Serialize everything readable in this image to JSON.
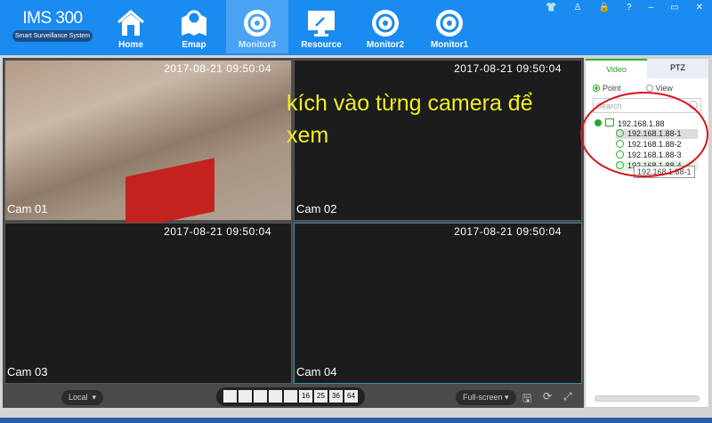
{
  "app": {
    "title": "IMS 300",
    "subtitle": "Smart Surveillance System"
  },
  "nav": [
    {
      "label": "Home",
      "icon": "home-icon"
    },
    {
      "label": "Emap",
      "icon": "map-pin-icon"
    },
    {
      "label": "Monitor3",
      "icon": "camera-icon",
      "active": true
    },
    {
      "label": "Resource",
      "icon": "wrench-monitor-icon"
    },
    {
      "label": "Monitor2",
      "icon": "camera-icon"
    },
    {
      "label": "Monitor1",
      "icon": "camera-icon"
    }
  ],
  "window_controls": [
    "shirt-icon",
    "user-icon",
    "lock-icon",
    "help-icon",
    "minimize-icon",
    "maximize-icon",
    "close-icon"
  ],
  "cameras": [
    {
      "name": "Cam 01",
      "timestamp": "2017-08-21  09:50:04"
    },
    {
      "name": "Cam 02",
      "timestamp": "2017-08-21  09:50:04"
    },
    {
      "name": "Cam 03",
      "timestamp": "2017-08-21  09:50:04"
    },
    {
      "name": "Cam 04",
      "timestamp": "2017-08-21  09:50:04"
    }
  ],
  "annotation": "kích vào từng camera để xem",
  "toolbar": {
    "source": "Local",
    "layouts": [
      "1",
      "4",
      "6",
      "8",
      "9",
      "16",
      "25",
      "36",
      "64"
    ],
    "fullscreen": "Full-screen"
  },
  "panel": {
    "tabs": [
      "Video",
      "PTZ"
    ],
    "radio_point": "Point",
    "radio_view": "View",
    "search_placeholder": "Search",
    "device": "192.168.1.88",
    "channels": [
      "192.168.1.88-1",
      "192.168.1.88-2",
      "192.168.1.88-3",
      "192.168.1.88-4"
    ],
    "tooltip": "192.168.1.88-1"
  },
  "colors": {
    "topbar": "#1a8bf0",
    "annotation": "#f2ee1e",
    "highlight": "#d8141b"
  }
}
